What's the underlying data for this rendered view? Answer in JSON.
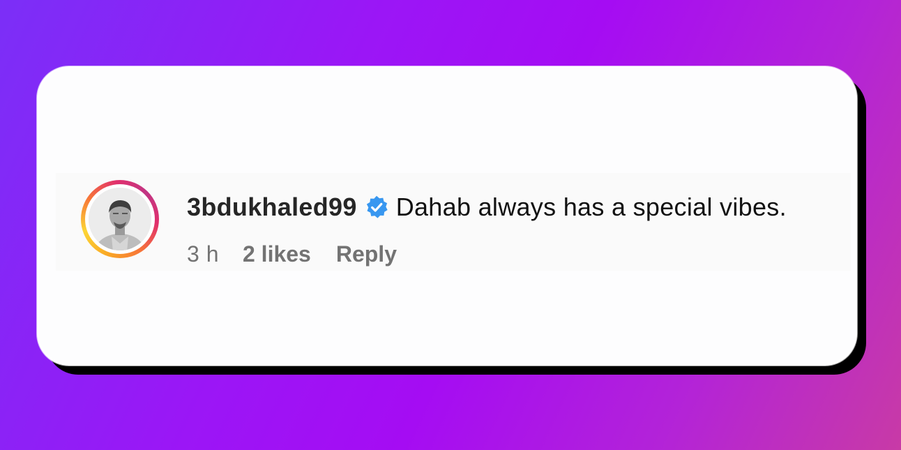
{
  "comment": {
    "username": "3bdukhaled99",
    "verified_icon": "verified-badge-icon",
    "text": "Dahab always has a special vibes.",
    "time": "3 h",
    "likes": "2 likes",
    "reply_label": "Reply",
    "avatar_icon": "user-avatar"
  },
  "colors": {
    "verified": "#3897f0",
    "username": "#262626",
    "meta": "#737373",
    "card_background": "#fdfdfe"
  }
}
